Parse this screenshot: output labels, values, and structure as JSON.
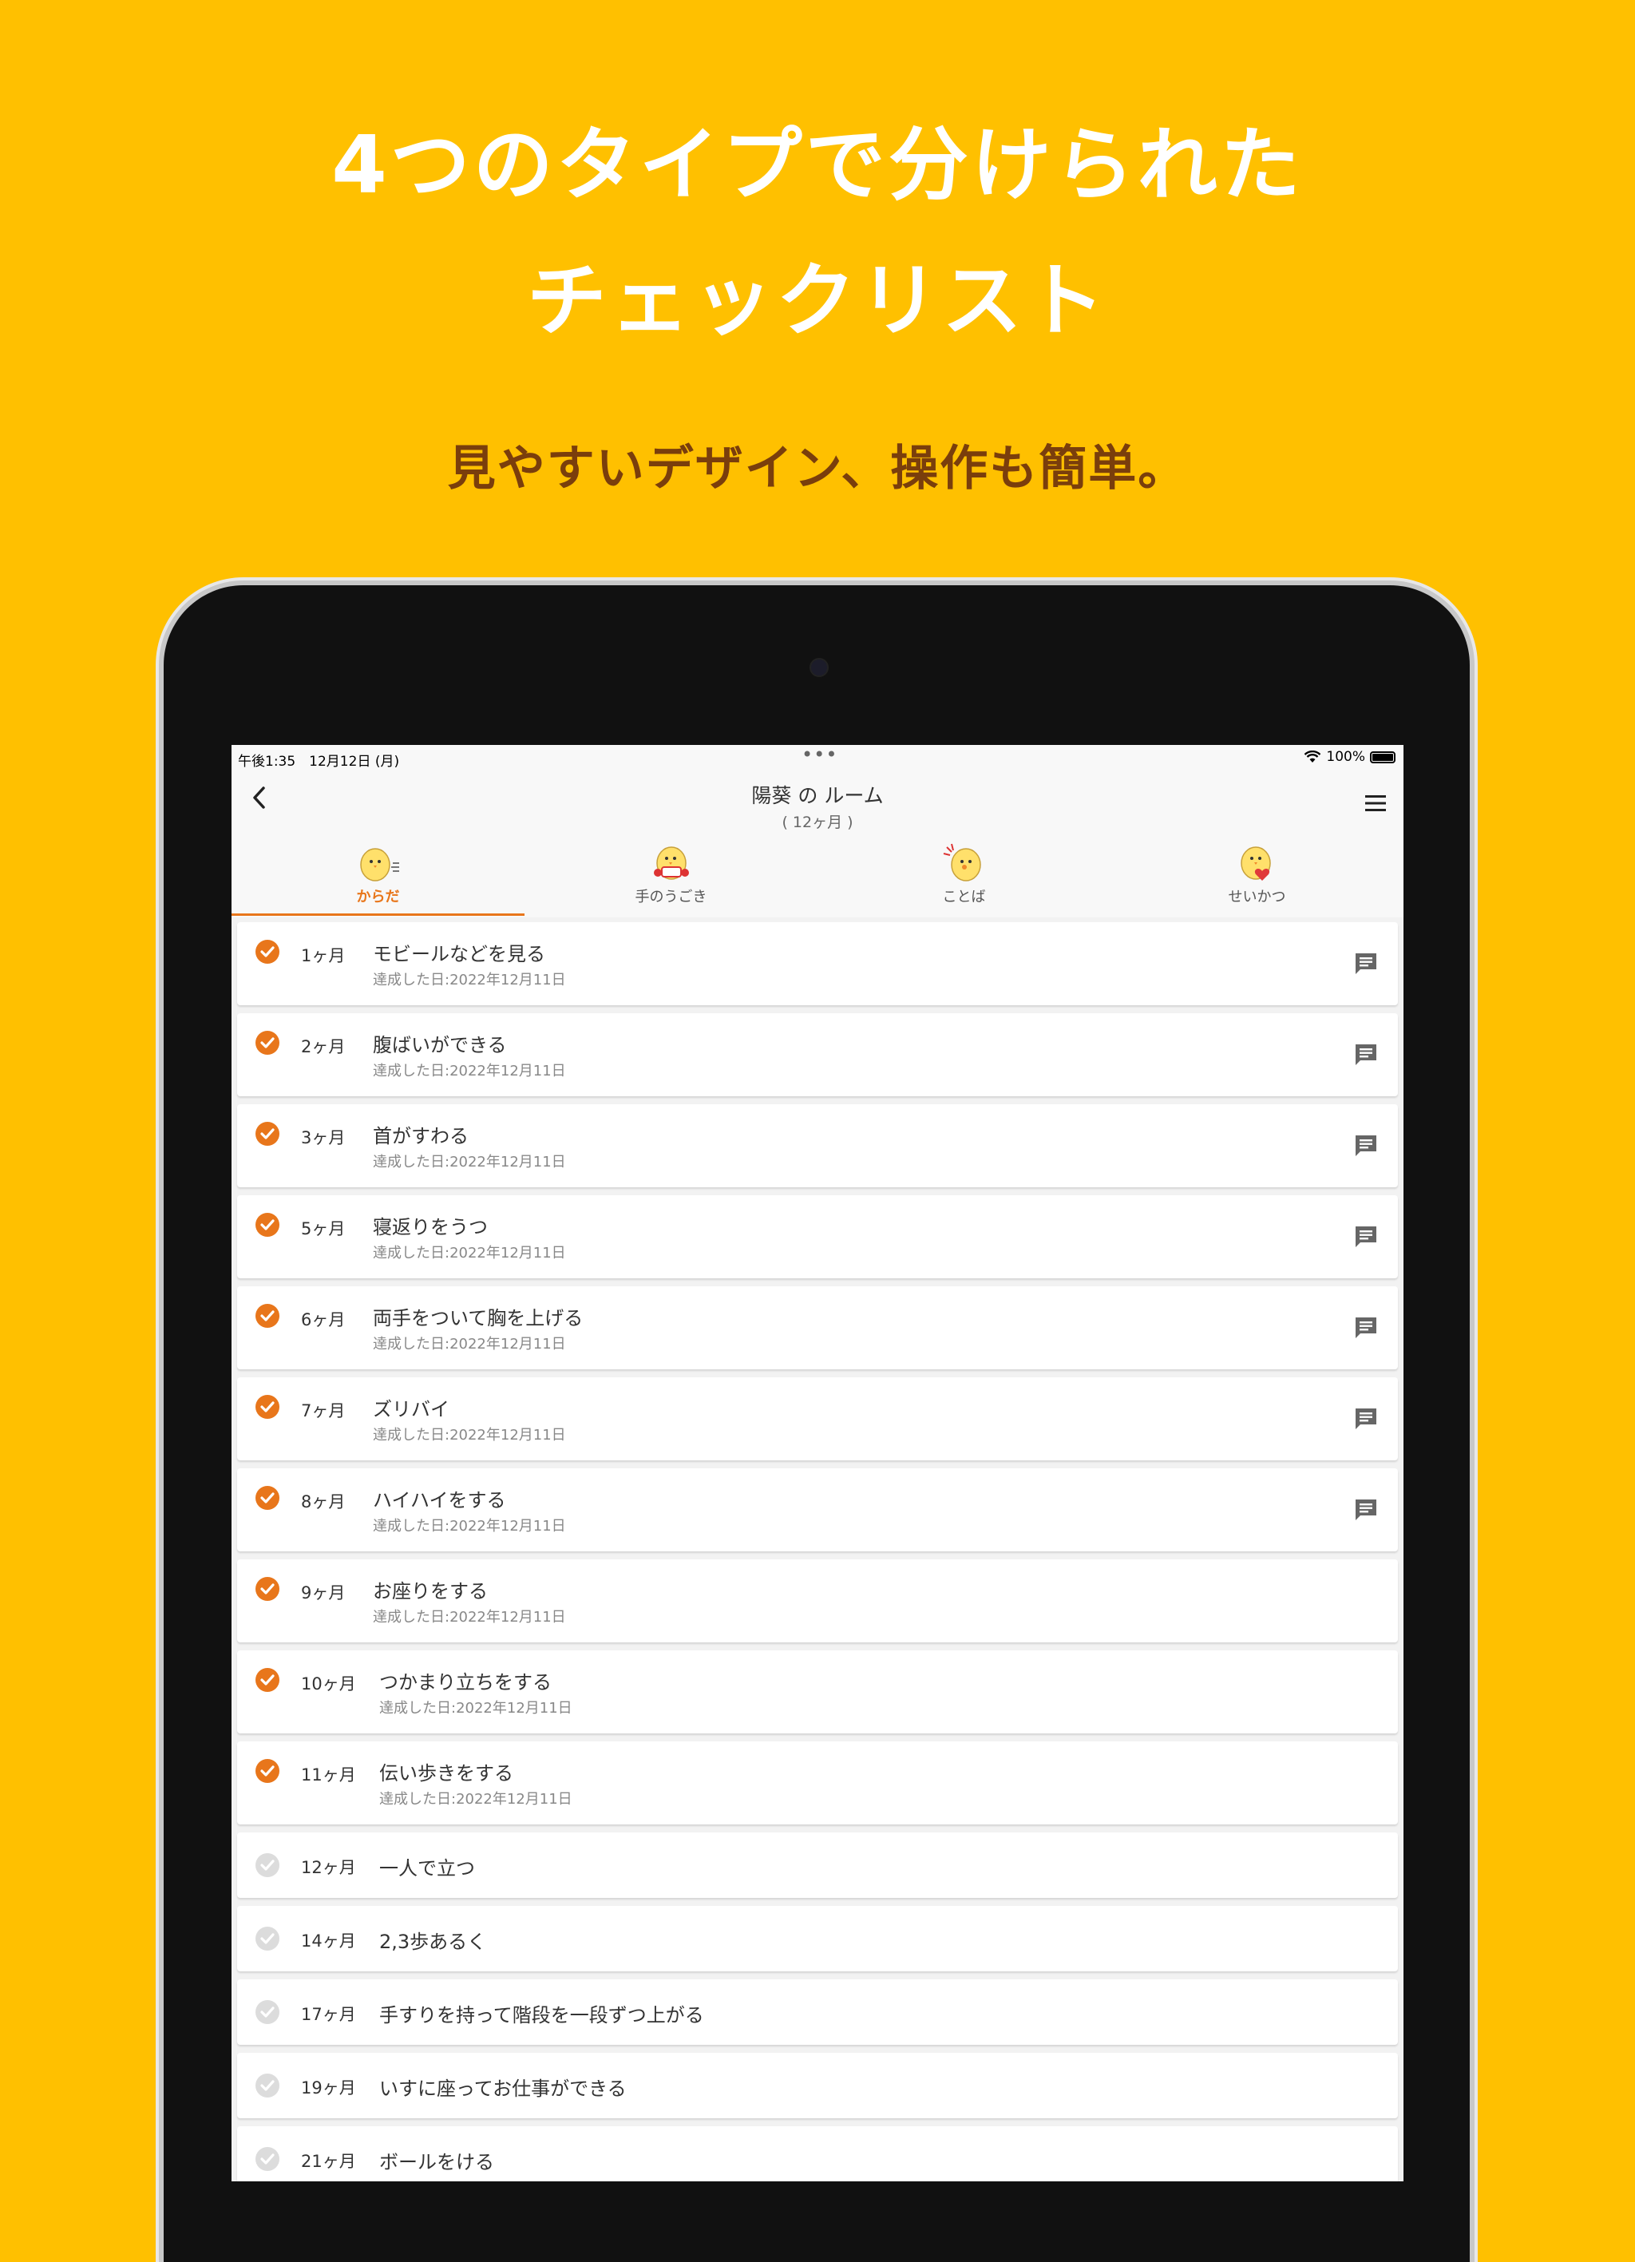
{
  "promo": {
    "headline_line1": "4つのタイプで分けられた",
    "headline_line2": "チェックリスト",
    "subheadline": "見やすいデザイン、操作も簡単。"
  },
  "status_bar": {
    "time": "午後1:35　12月12日 (月)",
    "dots": "•••",
    "battery": "100%"
  },
  "nav": {
    "title": "陽葵 の ルーム",
    "subtitle": "( 12ヶ月 )"
  },
  "tabs": [
    {
      "label": "からだ",
      "active": true
    },
    {
      "label": "手のうごき",
      "active": false
    },
    {
      "label": "ことば",
      "active": false
    },
    {
      "label": "せいかつ",
      "active": false
    }
  ],
  "checklist": [
    {
      "month": "1ヶ月",
      "title": "モビールなどを見る",
      "date": "達成した日:2022年12月11日",
      "done": true,
      "has_comment": true
    },
    {
      "month": "2ヶ月",
      "title": "腹ばいができる",
      "date": "達成した日:2022年12月11日",
      "done": true,
      "has_comment": true
    },
    {
      "month": "3ヶ月",
      "title": "首がすわる",
      "date": "達成した日:2022年12月11日",
      "done": true,
      "has_comment": true
    },
    {
      "month": "5ヶ月",
      "title": "寝返りをうつ",
      "date": "達成した日:2022年12月11日",
      "done": true,
      "has_comment": true
    },
    {
      "month": "6ヶ月",
      "title": "両手をついて胸を上げる",
      "date": "達成した日:2022年12月11日",
      "done": true,
      "has_comment": true
    },
    {
      "month": "7ヶ月",
      "title": "ズリバイ",
      "date": "達成した日:2022年12月11日",
      "done": true,
      "has_comment": true
    },
    {
      "month": "8ヶ月",
      "title": "ハイハイをする",
      "date": "達成した日:2022年12月11日",
      "done": true,
      "has_comment": true
    },
    {
      "month": "9ヶ月",
      "title": "お座りをする",
      "date": "達成した日:2022年12月11日",
      "done": true,
      "has_comment": false
    },
    {
      "month": "10ヶ月",
      "title": "つかまり立ちをする",
      "date": "達成した日:2022年12月11日",
      "done": true,
      "has_comment": false
    },
    {
      "month": "11ヶ月",
      "title": "伝い歩きをする",
      "date": "達成した日:2022年12月11日",
      "done": true,
      "has_comment": false
    },
    {
      "month": "12ヶ月",
      "title": "一人で立つ",
      "date": "",
      "done": false,
      "has_comment": false
    },
    {
      "month": "14ヶ月",
      "title": "2,3歩あるく",
      "date": "",
      "done": false,
      "has_comment": false
    },
    {
      "month": "17ヶ月",
      "title": "手すりを持って階段を一段ずつ上がる",
      "date": "",
      "done": false,
      "has_comment": false
    },
    {
      "month": "19ヶ月",
      "title": "いすに座ってお仕事ができる",
      "date": "",
      "done": false,
      "has_comment": false
    },
    {
      "month": "21ヶ月",
      "title": "ボールをける",
      "date": "",
      "done": false,
      "has_comment": false
    }
  ],
  "colors": {
    "background": "#FFC000",
    "accent": "#E8761B",
    "subheadline": "#7A3E0C",
    "unchecked": "#DCDCDC"
  },
  "icons": {
    "back": "chevron-left-icon",
    "menu": "hamburger-menu-icon",
    "check": "check-circle-icon",
    "comment": "comment-icon",
    "wifi": "wifi-icon",
    "battery": "battery-icon"
  }
}
